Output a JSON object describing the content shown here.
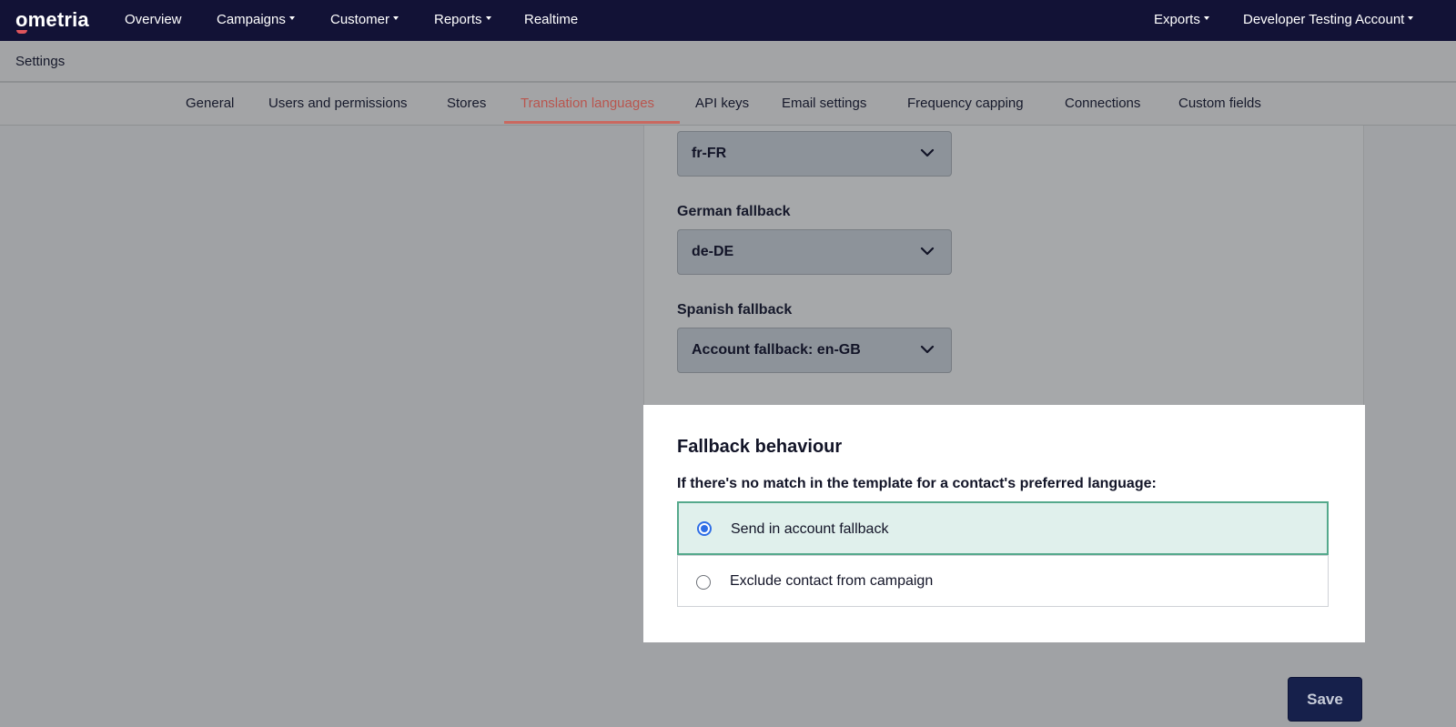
{
  "brand": {
    "logo_text": "ometria"
  },
  "topnav": {
    "left_items": [
      {
        "label": "Overview",
        "has_caret": false
      },
      {
        "label": "Campaigns",
        "has_caret": true
      },
      {
        "label": "Customer",
        "has_caret": true
      },
      {
        "label": "Reports",
        "has_caret": true
      },
      {
        "label": "Realtime",
        "has_caret": false
      }
    ],
    "right_items": [
      {
        "label": "Exports",
        "has_caret": true
      },
      {
        "label": "Developer Testing Account",
        "has_caret": true
      }
    ]
  },
  "settings_bar": {
    "title": "Settings"
  },
  "tabs": [
    {
      "label": "General"
    },
    {
      "label": "Users and permissions"
    },
    {
      "label": "Stores"
    },
    {
      "label": "Translation languages",
      "active": true
    },
    {
      "label": "API keys"
    },
    {
      "label": "Email settings"
    },
    {
      "label": "Frequency capping"
    },
    {
      "label": "Connections"
    },
    {
      "label": "Custom fields"
    }
  ],
  "language_fields": [
    {
      "label": "",
      "value": "fr-FR"
    },
    {
      "label": "German fallback",
      "value": "de-DE"
    },
    {
      "label": "Spanish fallback",
      "value": "Account fallback: en-GB"
    }
  ],
  "fallback": {
    "title": "Fallback behaviour",
    "subtitle": "If there's no match in the template for a contact's preferred language:",
    "options": [
      {
        "label": "Send in account fallback",
        "selected": true
      },
      {
        "label": "Exclude contact from campaign",
        "selected": false
      }
    ]
  },
  "actions": {
    "save_label": "Save"
  },
  "colors": {
    "nav_bg": "#121236",
    "active_tab": "#b9554e",
    "selected_option_bg": "#e0f0ec",
    "selected_border": "#55a98c",
    "radio_accent": "#2f6ee6",
    "save_bg": "#16204b"
  }
}
